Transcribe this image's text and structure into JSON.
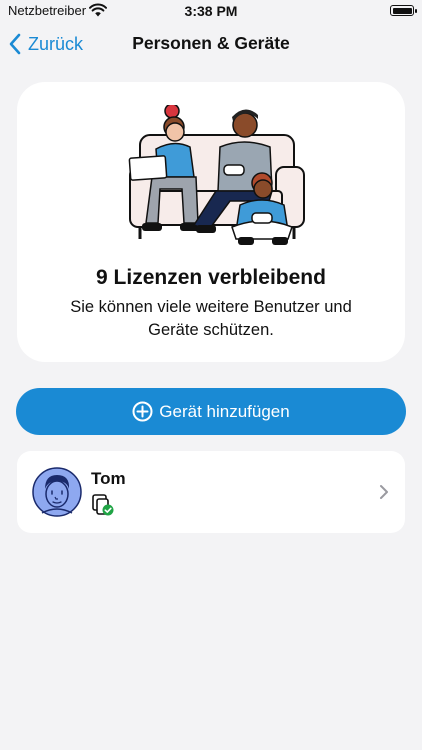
{
  "status_bar": {
    "carrier": "Netzbetreiber",
    "time": "3:38 PM",
    "icons": [
      "wifi-icon",
      "battery-icon"
    ]
  },
  "nav": {
    "back_label": "Zurück",
    "title": "Personen & Geräte"
  },
  "license_card": {
    "illustration": "family-on-couch-illustration",
    "title": "9 Lizenzen verbleibend",
    "subtitle": "Sie können viele weitere Benutzer und Geräte schützen."
  },
  "add_device": {
    "label": "Gerät hinzufügen",
    "icon": "plus-circle-icon"
  },
  "people": [
    {
      "name": "Tom",
      "avatar": "avatar-icon",
      "device_status": "device-protected-icon"
    }
  ],
  "colors": {
    "accent": "#1a8ad4",
    "background": "#f3f3f5",
    "card": "#ffffff",
    "avatar_fill": "#8ea8f0",
    "status_ok": "#20a445"
  }
}
